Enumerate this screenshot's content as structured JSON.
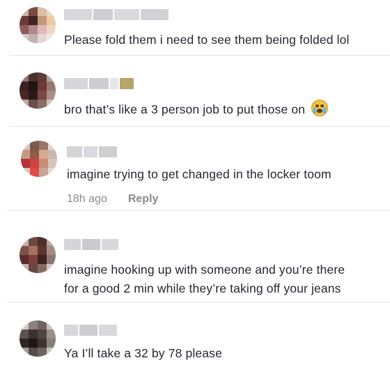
{
  "comments": [
    {
      "text": "Please fold them i need to see them being folded lol"
    },
    {
      "text": "bro that’s like a 3 person job to put those on",
      "emoji": "loudly-crying-face-emoji"
    },
    {
      "text": "imagine trying to get changed in the locker toom",
      "time": "18h ago",
      "reply": "Reply"
    },
    {
      "text_line1": "imagine hooking up with someone and you’re there",
      "text_line2": "for a good 2 min while they’re taking off your jeans"
    },
    {
      "text": "Ya I’ll take a 32 by 78 please"
    }
  ]
}
